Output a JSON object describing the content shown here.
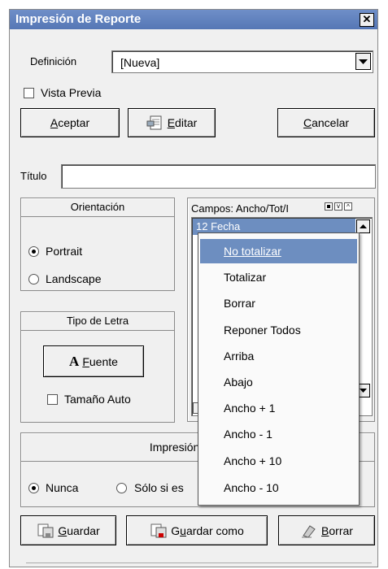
{
  "window": {
    "title": "Impresión de Reporte",
    "close_glyph": "✕"
  },
  "definicion": {
    "label": "Definición",
    "value": "[Nueva]"
  },
  "vista_previa": {
    "label": "Vista Previa",
    "checked": false
  },
  "buttons_top": {
    "aceptar": {
      "first": "A",
      "rest": "ceptar"
    },
    "editar": {
      "first": "E",
      "rest": "ditar"
    },
    "cancelar": {
      "first": "C",
      "rest": "ancelar"
    }
  },
  "titulo": {
    "label": "Título",
    "value": ""
  },
  "orientacion": {
    "title": "Orientación",
    "options": [
      {
        "label": "Portrait",
        "selected": true
      },
      {
        "label": "Landscape",
        "selected": false
      }
    ]
  },
  "tipo_letra": {
    "title": "Tipo de Letra",
    "fuente_glyph": "A",
    "fuente_first": "F",
    "fuente_rest": "uente",
    "tamano_auto": "Tamaño Auto"
  },
  "campos": {
    "header": "Campos: Ancho/Tot/I",
    "first_item": "12 Fecha"
  },
  "impresion": {
    "title": "Impresión del sepa",
    "options": [
      {
        "label": "Nunca",
        "selected": true
      },
      {
        "label": "Sólo si es",
        "selected": false
      }
    ]
  },
  "buttons_bottom": {
    "guardar": {
      "first": "G",
      "rest": "uardar"
    },
    "guardar_como": {
      "before": "G",
      "first": "u",
      "rest": "ardar como"
    },
    "borrar": {
      "first": "B",
      "rest": "orrar"
    }
  },
  "context_menu": {
    "items": [
      "No totalizar",
      "Totalizar",
      "Borrar",
      "Reponer Todos",
      "Arriba",
      "Abajo",
      "Ancho + 1",
      "Ancho - 1",
      "Ancho + 10",
      "Ancho - 10"
    ],
    "highlighted_index": 0,
    "highlight_color": "#6d8ec0"
  },
  "colors": {
    "titlebar": "#5e7fbe",
    "background": "#f0f0f0",
    "selection": "#6d8ec0"
  }
}
